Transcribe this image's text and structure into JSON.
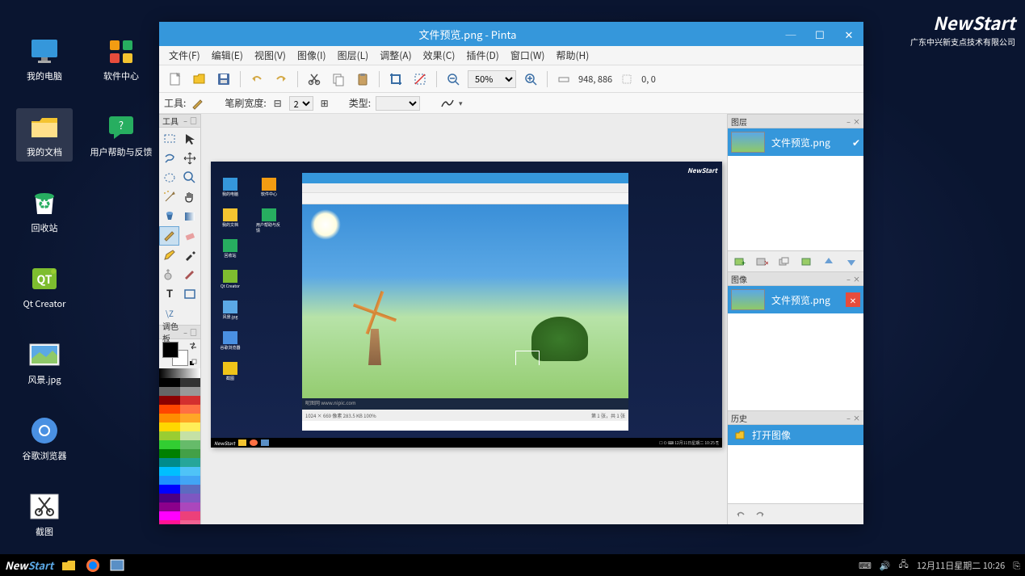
{
  "desktop": {
    "icons_col1": [
      {
        "label": "我的电脑",
        "icon": "monitor",
        "color": "#3597db"
      },
      {
        "label": "我的文档",
        "icon": "folder",
        "color": "#f4c430",
        "selected": true
      },
      {
        "label": "回收站",
        "icon": "trash",
        "color": "#27ae60"
      },
      {
        "label": "Qt Creator",
        "icon": "qt",
        "color": "#7ebd2f"
      },
      {
        "label": "风景.jpg",
        "icon": "image",
        "color": "#5ba8e5"
      },
      {
        "label": "谷歌浏览器",
        "icon": "chrome",
        "color": "#4a90e2"
      },
      {
        "label": "截图",
        "icon": "scissors",
        "color": "#f0c419"
      }
    ],
    "icons_col2": [
      {
        "label": "软件中心",
        "icon": "apps",
        "color": "#f39c12"
      },
      {
        "label": "用户帮助与反馈",
        "icon": "help",
        "color": "#27ae60"
      }
    ],
    "brand": "NewStart",
    "brand_sub": "广东中兴新支点技术有限公司"
  },
  "pinta": {
    "title": "文件预览.png - Pinta",
    "menu": [
      "文件(F)",
      "编辑(E)",
      "视图(V)",
      "图像(I)",
      "图层(L)",
      "调整(A)",
      "效果(C)",
      "插件(D)",
      "窗口(W)",
      "帮助(H)"
    ],
    "zoom": "50%",
    "coords": "948, 886",
    "cursor": "0, 0",
    "toolrow": {
      "tools_label": "工具:",
      "brush_label": "笔刷宽度:",
      "brush_width": "2",
      "type_label": "类型:"
    },
    "panels": {
      "tools": "工具",
      "palette": "调色板",
      "layers": "图层",
      "images": "图像",
      "history": "历史"
    },
    "layer_name": "文件预览.png",
    "image_name": "文件预览.png",
    "history_item": "打开图像",
    "palette_colors": [
      [
        "#000000",
        "#333333"
      ],
      [
        "#666666",
        "#999999"
      ],
      [
        "#8b0000",
        "#d32f2f"
      ],
      [
        "#ff4500",
        "#ff7043"
      ],
      [
        "#ff8c00",
        "#ffa726"
      ],
      [
        "#ffd700",
        "#ffee58"
      ],
      [
        "#9acd32",
        "#c5e1a5"
      ],
      [
        "#32cd32",
        "#66bb6a"
      ],
      [
        "#008000",
        "#43a047"
      ],
      [
        "#008b8b",
        "#26a69a"
      ],
      [
        "#00bfff",
        "#4fc3f7"
      ],
      [
        "#1e90ff",
        "#42a5f5"
      ],
      [
        "#0000ff",
        "#5c6bc0"
      ],
      [
        "#4b0082",
        "#7e57c2"
      ],
      [
        "#8b008b",
        "#ab47bc"
      ],
      [
        "#ff00ff",
        "#ec407a"
      ],
      [
        "#ff1493",
        "#f06292"
      ],
      [
        "#dc143c",
        "#ef5350"
      ]
    ]
  },
  "taskbar": {
    "clock": "12月11日星期二 10:26"
  }
}
